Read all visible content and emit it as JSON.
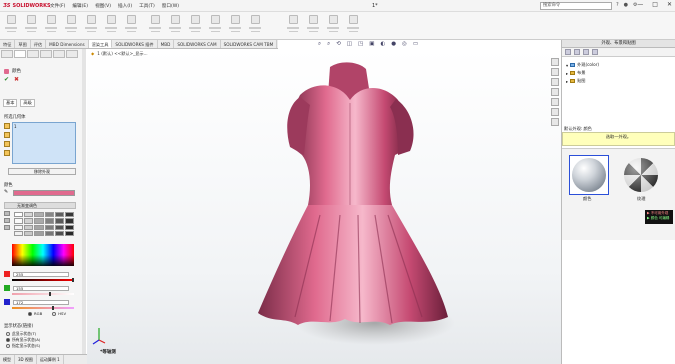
{
  "titlebar": {
    "logo_ds": "ƷS",
    "logo_text": "SOLIDWORKS",
    "menus": [
      "文件(F)",
      "编辑(E)",
      "视图(V)",
      "插入(I)",
      "工具(T)",
      "窗口(W)"
    ],
    "doc_title": "1*",
    "search_placeholder": "搜索命令",
    "window_controls": [
      "—",
      "□",
      "✕"
    ]
  },
  "tabs": [
    "特征",
    "草图",
    "评估",
    "MBD Dimensions",
    "渲染工具",
    "SOLIDWORKS 插件",
    "MBD",
    "SOLIDWORKS CAM",
    "SOLIDWORKS CAM TBM"
  ],
  "active_tab_index": 4,
  "tree_flyout": "1 (默认) <<默认>_显示...",
  "left_panel": {
    "title": "颜色",
    "subtabs": [
      "基本",
      "高级"
    ],
    "sel_header": "所选几何体",
    "sel_item": "1",
    "remove_button": "移除外观",
    "color_header": "颜色",
    "style_label": "无渐变调色",
    "rgb": {
      "r": "255",
      "g": "155",
      "b": "172"
    },
    "rgb_fill": {
      "r": 1.0,
      "g": 0.61,
      "b": 0.67
    },
    "radio_rgb": "RGB",
    "radio_hsv": "HSV",
    "display_header": "显示状态(链接)",
    "display_options": [
      "此显示状态(T)",
      "所有显示状态(A)",
      "指定显示状态(S)"
    ],
    "display_selected": 1
  },
  "bottom_tabs": [
    "模型",
    "3D 视图",
    "运动算例 1"
  ],
  "view_label": "*等轴测",
  "right_panel": {
    "title": "外观、布景和贴图",
    "tree": [
      {
        "label": "外观(color)",
        "level": 0,
        "expanded": true
      },
      {
        "label": "布景",
        "level": 0,
        "expanded": false
      },
      {
        "label": "贴图",
        "level": 0,
        "expanded": false
      }
    ],
    "lower_header": "默认外观: 颜色",
    "hint": "选取一外观。",
    "thumbnails": [
      {
        "label": "颜色"
      },
      {
        "label": "纹理"
      }
    ],
    "legend": [
      "▶ 不可用外观",
      "▶ 颜色 可编辑"
    ]
  },
  "colors": {
    "model": "#e06a8e",
    "accent_blue": "#2b4fd8",
    "selection_box": "#cfe3f7",
    "hint_bg": "#ffffbb"
  }
}
